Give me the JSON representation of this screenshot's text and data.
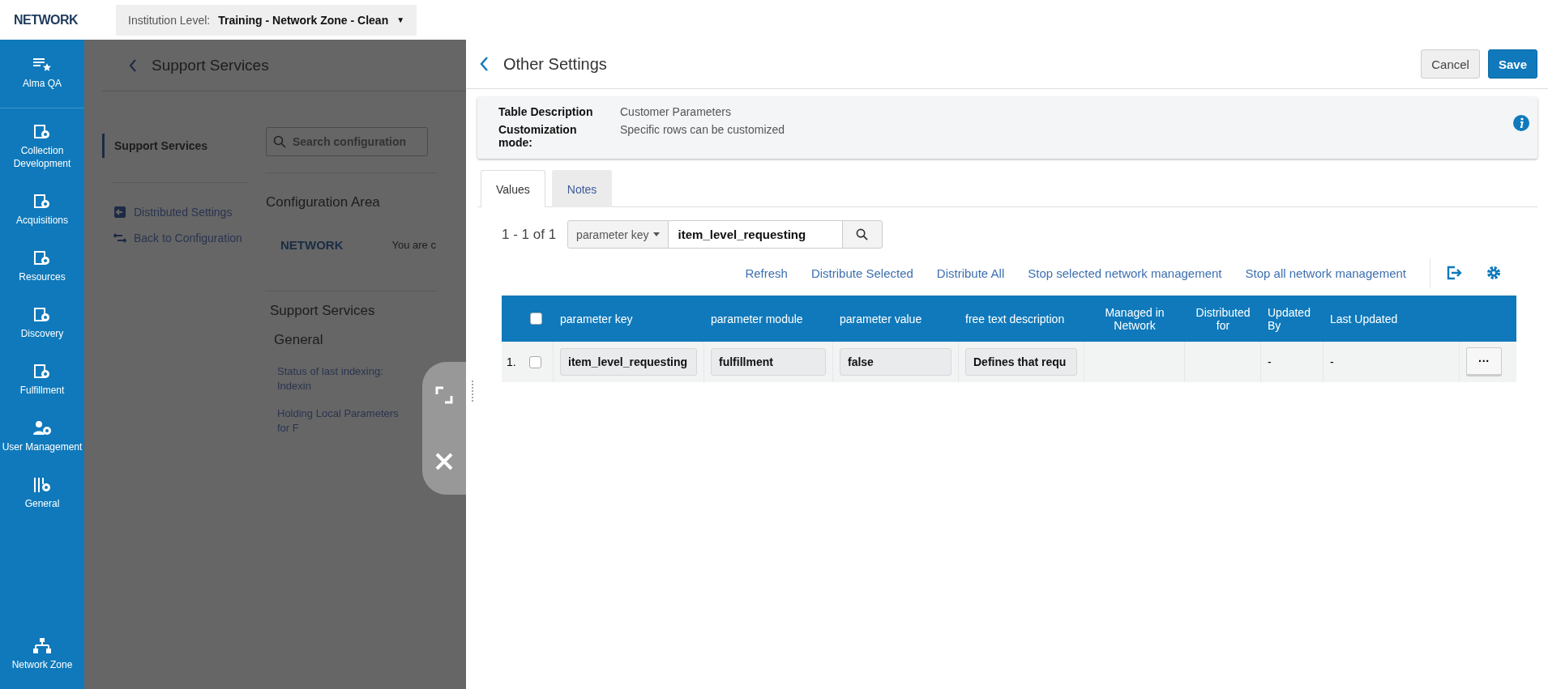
{
  "header": {
    "logo": "NETWORK",
    "institution_label": "Institution Level:",
    "institution_value": "Training - Network Zone - Clean",
    "caret": "▼"
  },
  "sidebar": {
    "items": [
      {
        "label": "Alma QA",
        "kind": "list-star"
      },
      {
        "label": "Collection Development",
        "kind": "gear"
      },
      {
        "label": "Acquisitions",
        "kind": "gear"
      },
      {
        "label": "Resources",
        "kind": "gear"
      },
      {
        "label": "Discovery",
        "kind": "gear"
      },
      {
        "label": "Fulfillment",
        "kind": "gear"
      },
      {
        "label": "User Management",
        "kind": "user-gear"
      },
      {
        "label": "General",
        "kind": "sliders"
      }
    ],
    "bottom_item": {
      "label": "Network Zone"
    }
  },
  "background_page": {
    "title": "Support Services",
    "nav_selected": "Support Services",
    "nav_links": [
      "Distributed Settings",
      "Back to Configuration"
    ],
    "search_placeholder": "Search configuration",
    "section_title": "Configuration Area",
    "network_logo": "NETWORK",
    "network_text": "You are c",
    "group_title": "Support Services",
    "subgroup_title": "General",
    "links": [
      "Status of last indexing: Indexin",
      "Holding Local Parameters for F"
    ]
  },
  "panel": {
    "title": "Other Settings",
    "buttons": [
      {
        "label": "Cancel",
        "kind": "secondary"
      },
      {
        "label": "Save",
        "kind": "primary"
      }
    ],
    "info": [
      {
        "label": "Table Description",
        "value": "Customer Parameters"
      },
      {
        "label": "Customization mode:",
        "value": "Specific rows can be customized"
      }
    ],
    "tabs": [
      {
        "label": "Values",
        "selected": true
      },
      {
        "label": "Notes",
        "selected": false
      }
    ],
    "pager": "1 - 1 of 1",
    "filter_field": "parameter key",
    "filter_value": "item_level_requesting",
    "actions": [
      "Refresh",
      "Distribute Selected",
      "Distribute All",
      "Stop selected network management",
      "Stop all network management"
    ],
    "table": {
      "select_all_checked": false,
      "columns": [
        "parameter key",
        "parameter module",
        "parameter value",
        "free text description",
        "Managed in Network",
        "Distributed for",
        "Updated By",
        "Last Updated"
      ],
      "rows": [
        {
          "number": "1.",
          "checked": false,
          "parameter_key": "item_level_requesting",
          "parameter_module": "fulfillment",
          "parameter_value": "false",
          "description": "Defines that requ",
          "managed_in_network": "",
          "distributed_for": "",
          "updated_by": "-",
          "last_updated": "-",
          "menu": "···"
        }
      ]
    }
  }
}
